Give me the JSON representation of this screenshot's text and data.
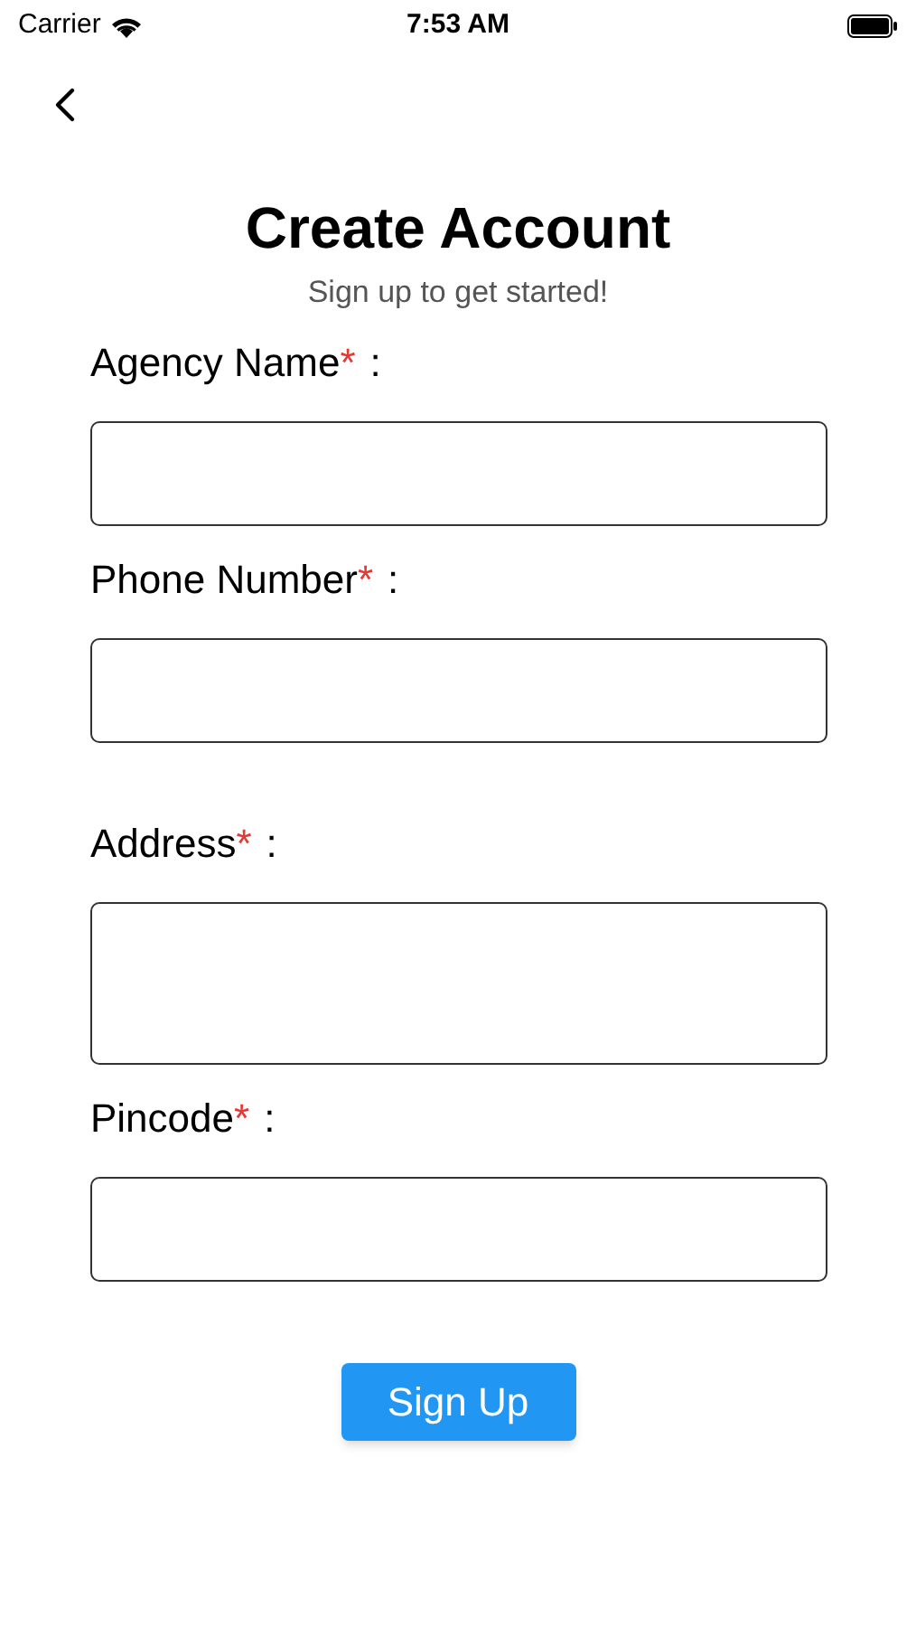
{
  "status_bar": {
    "carrier": "Carrier",
    "time": "7:53 AM"
  },
  "header": {
    "title": "Create Account",
    "subtitle": "Sign up to get started!"
  },
  "fields": [
    {
      "label": "Agency Name",
      "marker": "*",
      "suffix": ":",
      "kind": "single"
    },
    {
      "label": "Phone Number",
      "marker": "*",
      "suffix": ":",
      "kind": "single"
    },
    {
      "label": "Address",
      "marker": "*",
      "suffix": ":",
      "kind": "multiline"
    },
    {
      "label": "Pincode",
      "marker": "*",
      "suffix": ":",
      "kind": "single"
    }
  ],
  "submit": {
    "label": "Sign Up"
  }
}
